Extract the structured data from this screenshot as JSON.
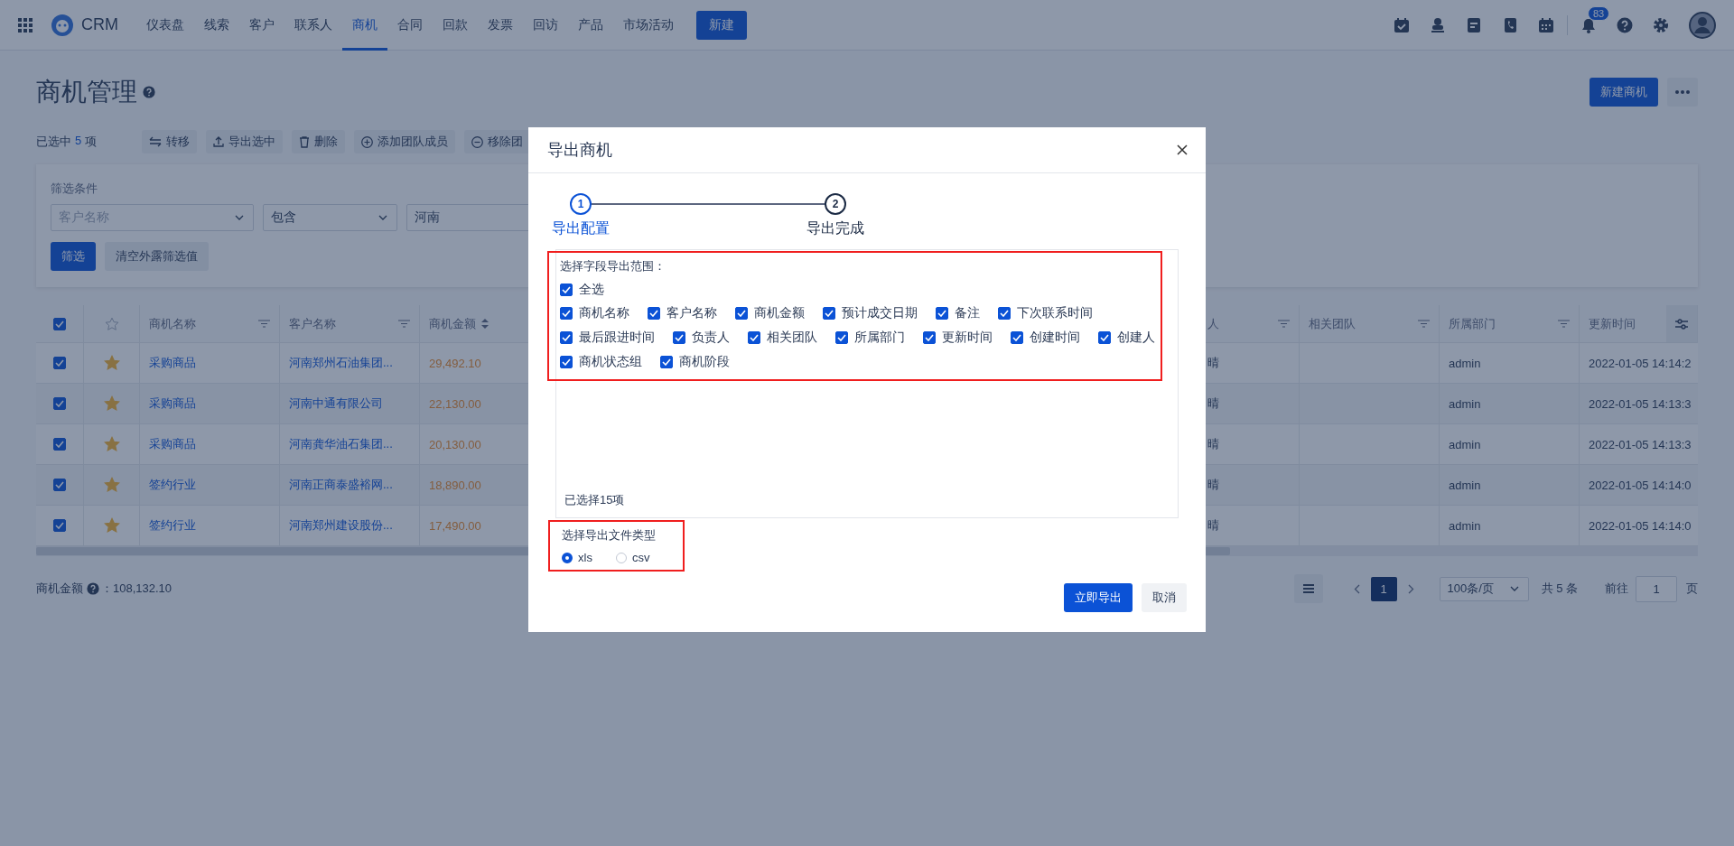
{
  "nav": {
    "brand": "CRM",
    "items": [
      {
        "label": "仪表盘",
        "selected": false
      },
      {
        "label": "线索",
        "selected": false
      },
      {
        "label": "客户",
        "selected": false
      },
      {
        "label": "联系人",
        "selected": false
      },
      {
        "label": "商机",
        "selected": true
      },
      {
        "label": "合同",
        "selected": false
      },
      {
        "label": "回款",
        "selected": false
      },
      {
        "label": "发票",
        "selected": false
      },
      {
        "label": "回访",
        "selected": false
      },
      {
        "label": "产品",
        "selected": false
      },
      {
        "label": "市场活动",
        "selected": false
      }
    ],
    "new_button": "新建",
    "notification_count": "83"
  },
  "page": {
    "title": "商机管理",
    "new_button": "新建商机"
  },
  "toolbar": {
    "selected_prefix": "已选中",
    "selected_count": "5",
    "selected_suffix": "项",
    "actions": [
      {
        "kind": "transfer",
        "label": "转移"
      },
      {
        "kind": "upload",
        "label": "导出选中"
      },
      {
        "kind": "trash",
        "label": "删除"
      },
      {
        "kind": "add",
        "label": "添加团队成员"
      },
      {
        "kind": "remove",
        "label": "移除团"
      }
    ]
  },
  "filter": {
    "label": "筛选条件",
    "field_placeholder": "客户名称",
    "operator": "包含",
    "value": "河南",
    "apply_button": "筛选",
    "clear_button": "清空外露筛选值"
  },
  "table": {
    "all_checked": true,
    "columns_left": [
      {
        "label": "商机名称",
        "kind": "filter"
      },
      {
        "label": "客户名称",
        "kind": "filter"
      },
      {
        "label": "商机金额",
        "kind": "sort"
      }
    ],
    "columns_right": [
      {
        "label": "人",
        "kind": "filter"
      },
      {
        "label": "相关团队",
        "kind": "filter"
      },
      {
        "label": "所属部门",
        "kind": "filter"
      },
      {
        "label": "更新时间",
        "kind": "settings"
      }
    ],
    "rows": [
      {
        "checked": true,
        "starred": true,
        "name": "采购商品",
        "customer": "河南郑州石油集团...",
        "amount": "29,492.10",
        "column_7": "晴",
        "department": "admin",
        "updated": "2022-01-05 14:14:2"
      },
      {
        "checked": true,
        "starred": true,
        "name": "采购商品",
        "customer": "河南中通有限公司",
        "amount": "22,130.00",
        "column_7": "晴",
        "department": "admin",
        "updated": "2022-01-05 14:13:3"
      },
      {
        "checked": true,
        "starred": true,
        "name": "采购商品",
        "customer": "河南龚华油石集团...",
        "amount": "20,130.00",
        "column_7": "晴",
        "department": "admin",
        "updated": "2022-01-05 14:13:3"
      },
      {
        "checked": true,
        "starred": true,
        "name": "签约行业",
        "customer": "河南正商泰盛裕网...",
        "amount": "18,890.00",
        "column_7": "晴",
        "department": "admin",
        "updated": "2022-01-05 14:14:0"
      },
      {
        "checked": true,
        "starred": true,
        "name": "签约行业",
        "customer": "河南郑州建设股份...",
        "amount": "17,490.00",
        "column_7": "晴",
        "department": "admin",
        "updated": "2022-01-05 14:14:0"
      }
    ]
  },
  "summary": {
    "label": "商机金额",
    "value": "：108,132.10"
  },
  "pagination": {
    "pages": [
      {
        "label": "1",
        "selected": true
      }
    ],
    "page_size": "100条/页",
    "total": "共 5 条",
    "goto_label": "前往",
    "goto_value": "1",
    "goto_suffix": "页"
  },
  "modal": {
    "title": "导出商机",
    "steps": [
      {
        "number": "1",
        "label": "导出配置",
        "selected": true
      },
      {
        "number": "2",
        "label": "导出完成",
        "selected": false
      }
    ],
    "fields_label": "选择字段导出范围：",
    "select_all": {
      "label": "全选",
      "checked": true
    },
    "fields": [
      {
        "label": "商机名称",
        "checked": true
      },
      {
        "label": "客户名称",
        "checked": true
      },
      {
        "label": "商机金额",
        "checked": true
      },
      {
        "label": "预计成交日期",
        "checked": true
      },
      {
        "label": "备注",
        "checked": true
      },
      {
        "label": "下次联系时间",
        "checked": true
      },
      {
        "label": "最后跟进时间",
        "checked": true
      },
      {
        "label": "负责人",
        "checked": true
      },
      {
        "label": "相关团队",
        "checked": true
      },
      {
        "label": "所属部门",
        "checked": true
      },
      {
        "label": "更新时间",
        "checked": true
      },
      {
        "label": "创建时间",
        "checked": true
      },
      {
        "label": "创建人",
        "checked": true
      },
      {
        "label": "商机状态组",
        "checked": true
      },
      {
        "label": "商机阶段",
        "checked": true
      }
    ],
    "selected_count": "已选择15项",
    "file_type_label": "选择导出文件类型",
    "file_types": [
      {
        "label": "xls",
        "selected": true
      },
      {
        "label": "csv",
        "selected": false
      }
    ],
    "export_button": "立即导出",
    "cancel_button": "取消"
  }
}
